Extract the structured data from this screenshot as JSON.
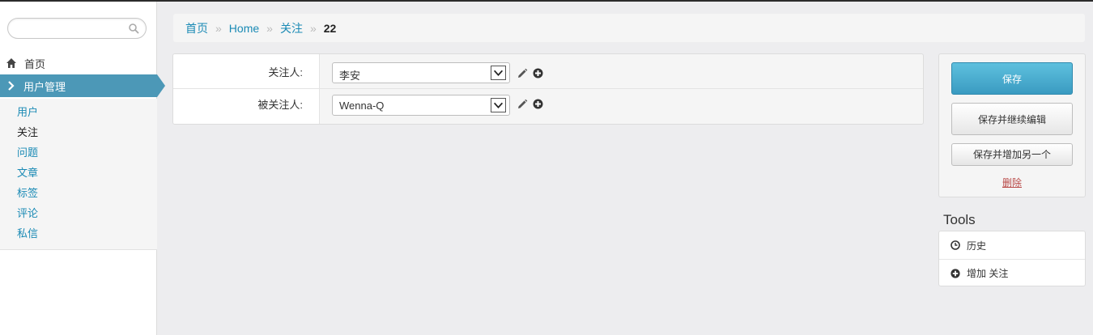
{
  "search": {
    "placeholder": ""
  },
  "nav": {
    "home_label": "首页",
    "section_label": "用户管理",
    "items": [
      {
        "label": "用户"
      },
      {
        "label": "关注"
      },
      {
        "label": "问题"
      },
      {
        "label": "文章"
      },
      {
        "label": "标签"
      },
      {
        "label": "评论"
      },
      {
        "label": "私信"
      }
    ],
    "current_item": "关注"
  },
  "breadcrumb": {
    "items": [
      "首页",
      "Home",
      "关注"
    ],
    "separator": "»",
    "current": "22"
  },
  "form": {
    "fields": [
      {
        "label": "关注人:",
        "value": "李安"
      },
      {
        "label": "被关注人:",
        "value": "Wenna-Q"
      }
    ]
  },
  "actions": {
    "save_label": "保存",
    "save_continue_label": "保存并继续编辑",
    "save_add_another_label": "保存并增加另一个",
    "delete_label": "删除"
  },
  "tools": {
    "title": "Tools",
    "items": [
      {
        "label": "历史",
        "icon": "clock-icon"
      },
      {
        "label": "增加 关注",
        "icon": "plus-circle-icon"
      }
    ]
  },
  "colors": {
    "accent": "#4c98b7",
    "link": "#1a8ab5",
    "primary_button": "#49adcf",
    "danger": "#b94a48"
  }
}
